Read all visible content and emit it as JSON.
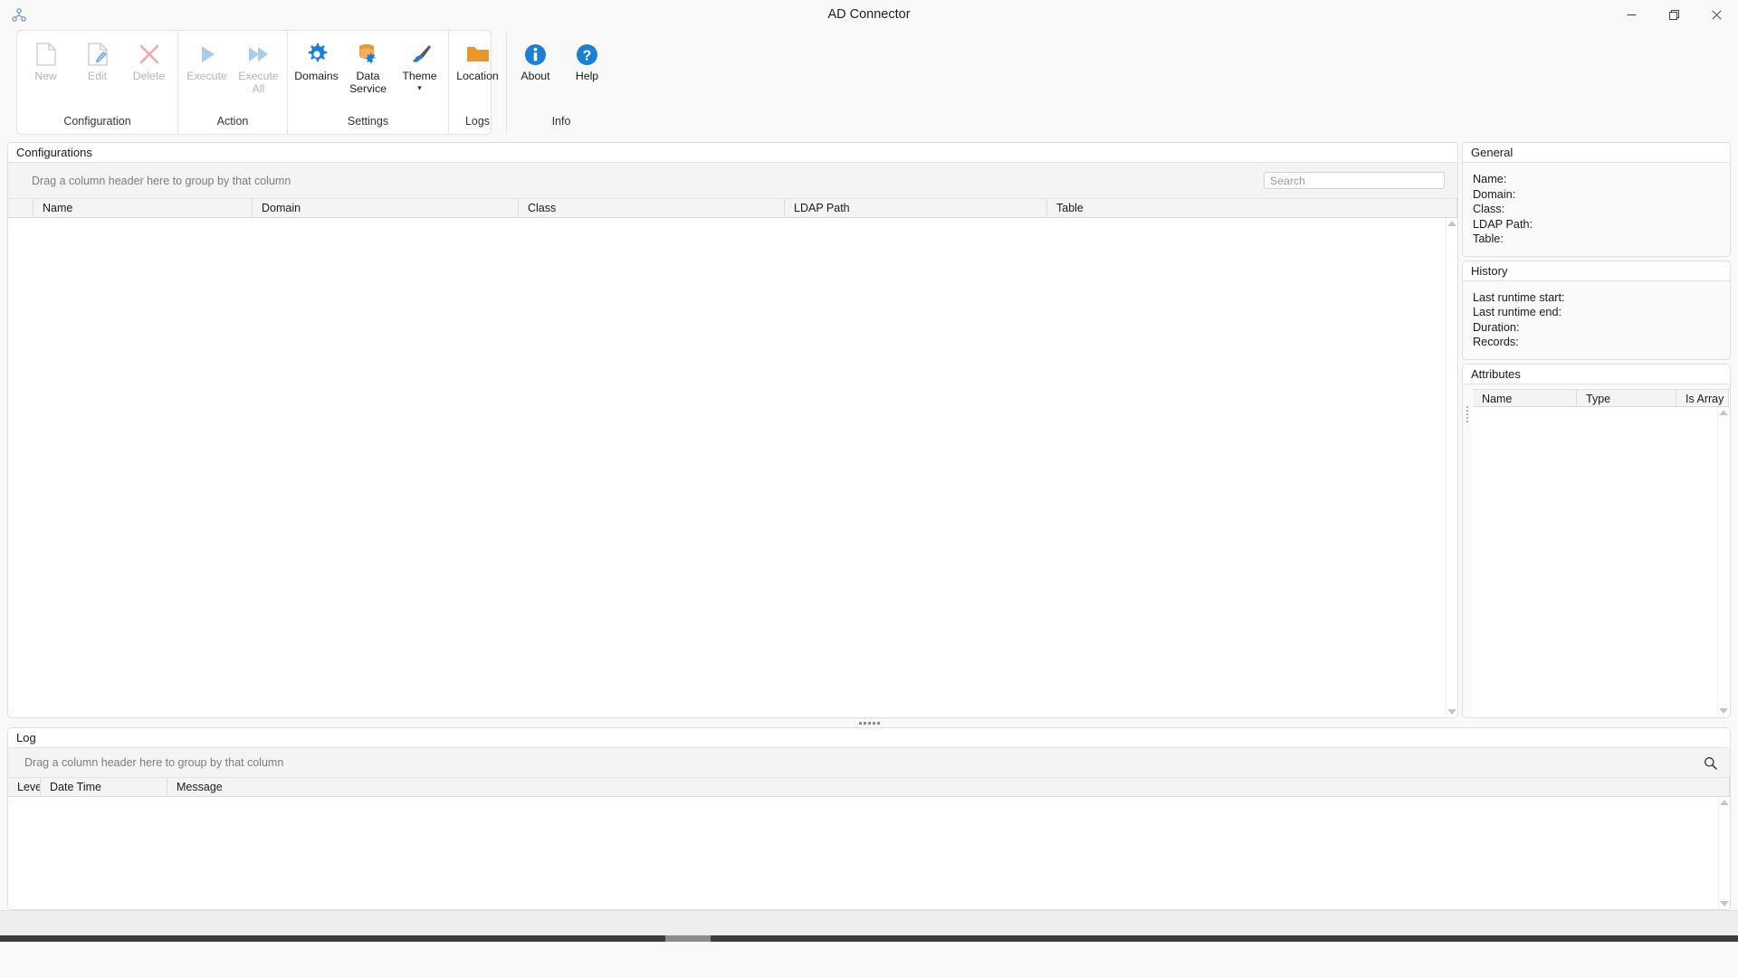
{
  "window": {
    "title": "AD Connector",
    "app_icon": "network-nodes-icon",
    "controls": [
      {
        "name": "minimize",
        "glyph": "—"
      },
      {
        "name": "restore",
        "glyph": "❐"
      },
      {
        "name": "close",
        "glyph": "✕"
      }
    ]
  },
  "ribbon": {
    "groups": [
      {
        "label": "Configuration",
        "buttons": [
          {
            "label": "New",
            "icon": "new-document-icon",
            "disabled": true
          },
          {
            "label": "Edit",
            "icon": "edit-document-icon",
            "disabled": true
          },
          {
            "label": "Delete",
            "icon": "delete-x-icon",
            "disabled": true
          }
        ]
      },
      {
        "label": "Action",
        "buttons": [
          {
            "label": "Execute",
            "icon": "play-icon",
            "disabled": true
          },
          {
            "label": "Execute All",
            "icon": "play-all-icon",
            "disabled": true
          }
        ]
      },
      {
        "label": "Settings",
        "buttons": [
          {
            "label": "Domains",
            "icon": "gear-icon",
            "disabled": false
          },
          {
            "label": "Data Service",
            "icon": "database-gear-icon",
            "disabled": false
          },
          {
            "label": "Theme",
            "icon": "paintbrush-icon",
            "disabled": false,
            "dropdown": true
          }
        ]
      },
      {
        "label": "Logs",
        "buttons": [
          {
            "label": "Location",
            "icon": "folder-icon",
            "disabled": false
          }
        ]
      },
      {
        "label": "Info",
        "buttons": [
          {
            "label": "About",
            "icon": "info-circle-icon",
            "disabled": false
          },
          {
            "label": "Help",
            "icon": "question-circle-icon",
            "disabled": false
          }
        ]
      }
    ]
  },
  "configurations": {
    "title": "Configurations",
    "group_hint": "Drag a column header here to group by that column",
    "search": {
      "value": "",
      "placeholder": "Search"
    },
    "columns": [
      "Name",
      "Domain",
      "Class",
      "LDAP Path",
      "Table"
    ],
    "rows": []
  },
  "general": {
    "title": "General",
    "fields": [
      {
        "label": "Name:",
        "value": ""
      },
      {
        "label": "Domain:",
        "value": ""
      },
      {
        "label": "Class:",
        "value": ""
      },
      {
        "label": "LDAP Path:",
        "value": ""
      },
      {
        "label": "Table:",
        "value": ""
      }
    ]
  },
  "history": {
    "title": "History",
    "fields": [
      {
        "label": "Last runtime start:",
        "value": ""
      },
      {
        "label": "Last runtime end:",
        "value": ""
      },
      {
        "label": "Duration:",
        "value": ""
      },
      {
        "label": "Records:",
        "value": ""
      }
    ]
  },
  "attributes": {
    "title": "Attributes",
    "columns": [
      "Name",
      "Type",
      "Is Array"
    ],
    "rows": []
  },
  "log": {
    "title": "Log",
    "group_hint": "Drag a column header here to group by that column",
    "search_icon": "search-icon",
    "columns": [
      "Level",
      "Date Time",
      "Message"
    ],
    "rows": []
  },
  "colors": {
    "accent_blue": "#1b7fd4",
    "accent_orange": "#e8972e",
    "disabled_gray": "#b4b4b4",
    "panel_bg": "#fafafa",
    "header_bg": "#f4f4f4",
    "taskbar": "#3b3b3b"
  }
}
